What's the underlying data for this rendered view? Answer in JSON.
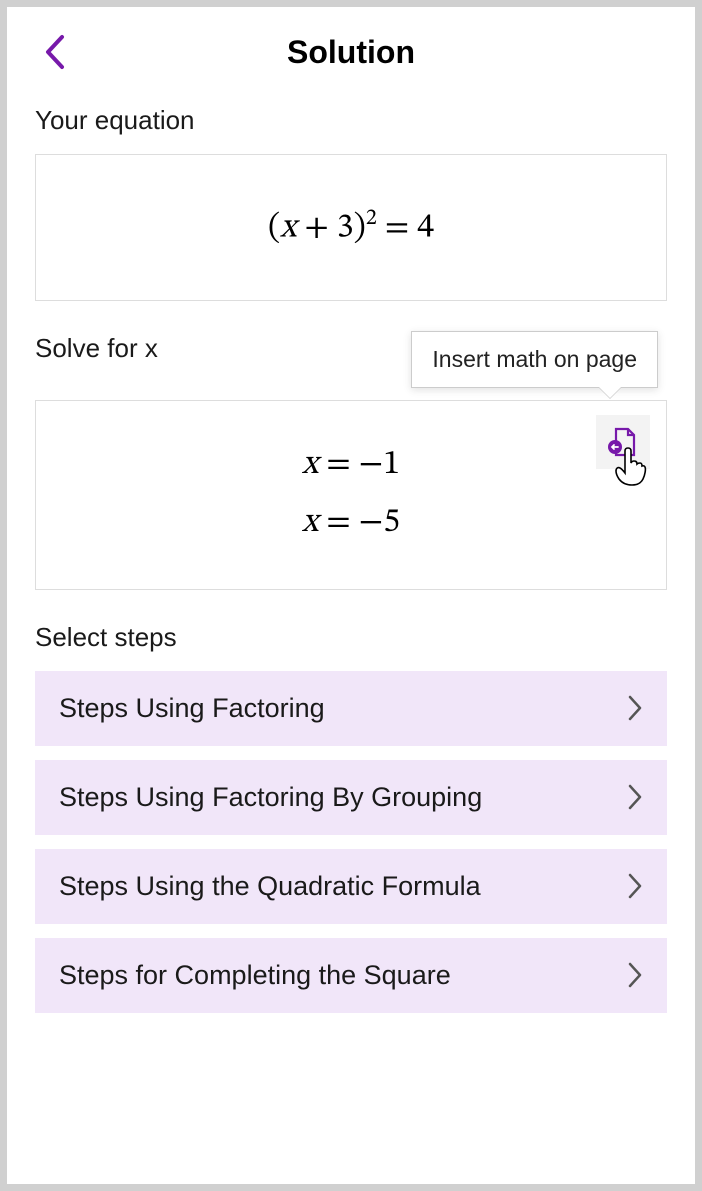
{
  "header": {
    "title": "Solution"
  },
  "equation_section": {
    "label": "Your equation",
    "equation_display": "(x + 3)² = 4"
  },
  "solve_section": {
    "label": "Solve for x",
    "solutions": [
      "x = −1",
      "x = −5"
    ],
    "tooltip": "Insert math on page"
  },
  "steps_section": {
    "label": "Select steps",
    "items": [
      "Steps Using Factoring",
      "Steps Using Factoring By Grouping",
      "Steps Using the Quadratic Formula",
      "Steps for Completing the Square"
    ]
  }
}
